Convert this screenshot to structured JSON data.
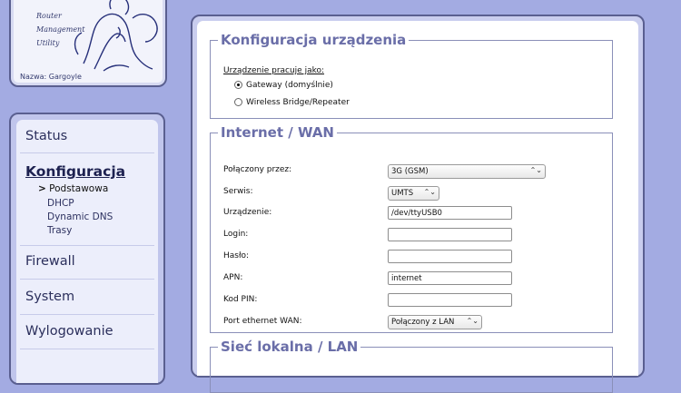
{
  "logo": {
    "words": [
      "Router",
      "Management",
      "Utility"
    ],
    "name_label": "Nazwa: Gargoyle"
  },
  "sidebar": {
    "items": [
      {
        "label": "Status"
      },
      {
        "label": "Konfiguracja"
      },
      {
        "label": "Firewall"
      },
      {
        "label": "System"
      },
      {
        "label": "Wylogowanie"
      }
    ],
    "subitems": [
      {
        "label": "Podstawowa"
      },
      {
        "label": "DHCP"
      },
      {
        "label": "Dynamic DNS"
      },
      {
        "label": "Trasy"
      }
    ],
    "current_marker": ">"
  },
  "device": {
    "legend": "Konfiguracja urządzenia",
    "mode_label": "Urządzenie pracuje jako:",
    "options": [
      {
        "label": "Gateway (domyślnie)",
        "selected": true
      },
      {
        "label": "Wireless Bridge/Repeater",
        "selected": false
      }
    ]
  },
  "wan": {
    "legend": "Internet / WAN",
    "rows": [
      {
        "label": "Połączony przez:",
        "value": "3G (GSM)"
      },
      {
        "label": "Serwis:",
        "value": "UMTS"
      },
      {
        "label": "Urządzenie:",
        "value": "/dev/ttyUSB0"
      },
      {
        "label": "Login:",
        "value": ""
      },
      {
        "label": "Hasło:",
        "value": ""
      },
      {
        "label": "APN:",
        "value": "internet"
      },
      {
        "label": "Kod PIN:",
        "value": ""
      },
      {
        "label": "Port ethernet WAN:",
        "value": "Połączony z LAN"
      }
    ]
  },
  "lan": {
    "legend": "Sieć lokalna / LAN"
  },
  "icons": {
    "select_arrow": "⌃⌄"
  }
}
